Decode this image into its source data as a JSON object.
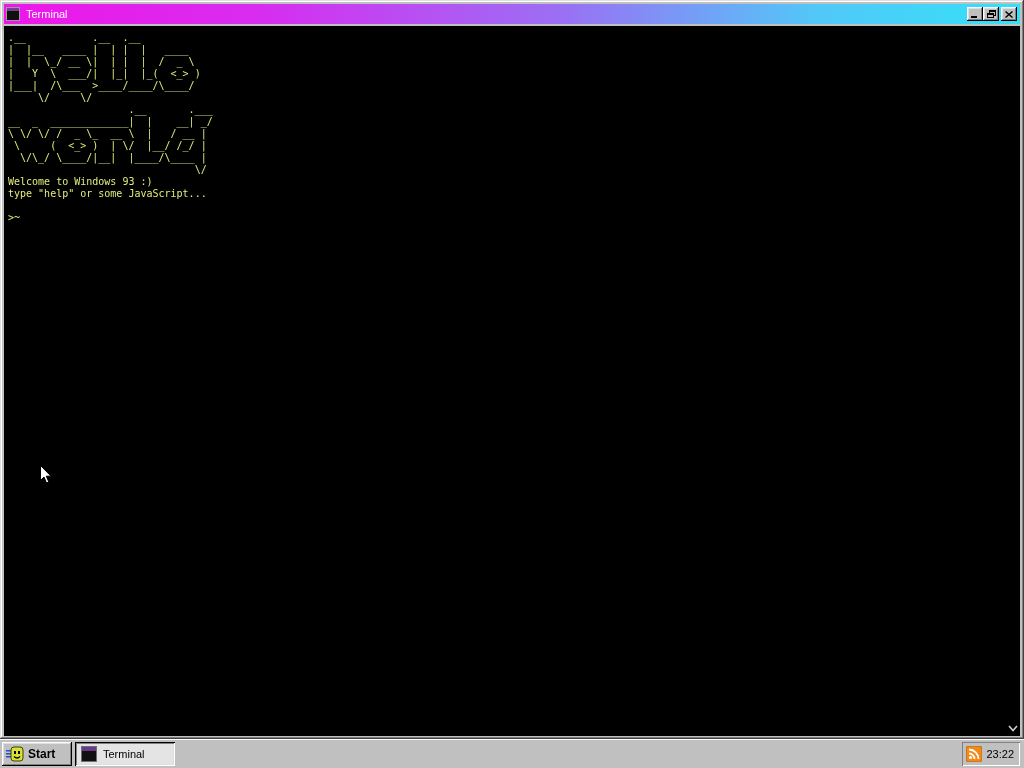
{
  "window": {
    "title": "Terminal"
  },
  "terminal": {
    "banner": [
      ".__           .__  .__",
      "|  |__   ____ |  | |  |   ____",
      "|  |  \\_/ __ \\|  | |  |  /  _ \\",
      "|   Y  \\  ___/|  |_|  |_(  <_> )",
      "|___|  /\\___  >____/____/\\____/",
      "     \\/     \\/",
      "                    .__       .___",
      "__  _  _____________|  |    __| _/",
      "\\ \\/ \\/ /  _ \\_  __ \\  |   / __ |",
      " \\     (  <_> )  | \\/  |__/ /_/ |",
      "  \\/\\_/ \\____/|__|  |____/\\____ |",
      "                               \\/"
    ],
    "messages": [
      "Welcome to Windows 93 :)",
      "type \"help\" or some JavaScript..."
    ],
    "prompt": ">~"
  },
  "taskbar": {
    "start": "Start",
    "tasks": [
      {
        "label": "Terminal",
        "selected": true
      }
    ],
    "clock": "23:22"
  }
}
